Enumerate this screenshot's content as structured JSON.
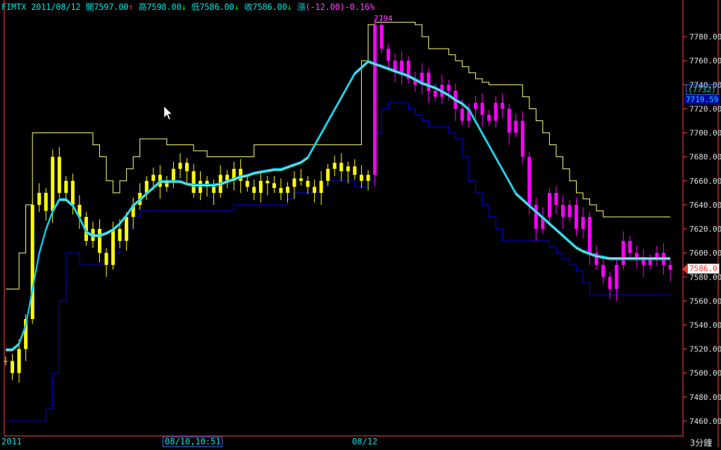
{
  "header": {
    "symbol": "FIMTX",
    "date": "2011/08/12",
    "open_label": "開",
    "open": "7597.00",
    "open_arrow": "↑",
    "high_label": "高",
    "high": "7598.00",
    "high_arrow": "↓",
    "low_label": "低",
    "low": "7586.00",
    "low_arrow": "↓",
    "close_label": "收",
    "close": "7586.00",
    "close_arrow": "↓",
    "change_label": "漲",
    "change": "(-12.00)-0.16%"
  },
  "bottom": {
    "year_label": "2011",
    "cursor_time": "08/10,10:51",
    "date_mark": "08/12",
    "period": "3分鐘"
  },
  "tags": {
    "peak_label": "7794",
    "marker_box": "(7732)",
    "indicator_value": "7719.59",
    "last_price": "7586.0"
  },
  "colors": {
    "background": "#000000",
    "up_candle": "#ffff00",
    "down_candle": "#ff00ff",
    "upper_band": "#ffff80",
    "lower_band": "#0000cc",
    "ma_cyan": "#00ccff",
    "ma_white": "#ffffff",
    "ma_green": "#00aa88",
    "axis_border": "#ff4040"
  },
  "chart_data": {
    "type": "line",
    "ylim": [
      7450,
      7800
    ],
    "y_ticks": [
      7460,
      7480,
      7500,
      7520,
      7540,
      7560,
      7580,
      7600,
      7620,
      7640,
      7660,
      7680,
      7700,
      7720,
      7740,
      7760,
      7780
    ],
    "close": [
      7510,
      7500,
      7520,
      7545,
      7640,
      7650,
      7635,
      7680,
      7650,
      7660,
      7640,
      7630,
      7610,
      7620,
      7600,
      7590,
      7620,
      7610,
      7630,
      7640,
      7650,
      7660,
      7665,
      7655,
      7660,
      7670,
      7675,
      7668,
      7650,
      7660,
      7655,
      7650,
      7665,
      7660,
      7670,
      7660,
      7655,
      7650,
      7660,
      7658,
      7654,
      7650,
      7655,
      7662,
      7660,
      7655,
      7650,
      7660,
      7670,
      7675,
      7668,
      7672,
      7665,
      7660,
      7665,
      7790,
      7770,
      7760,
      7750,
      7760,
      7745,
      7740,
      7750,
      7735,
      7730,
      7740,
      7735,
      7720,
      7710,
      7720,
      7725,
      7715,
      7710,
      7725,
      7720,
      7700,
      7710,
      7680,
      7640,
      7620,
      7630,
      7650,
      7640,
      7630,
      7640,
      7620,
      7630,
      7600,
      7590,
      7580,
      7570,
      7590,
      7610,
      7600,
      7595,
      7590,
      7595,
      7600,
      7590,
      7586
    ],
    "upper_band": [
      7570,
      7570,
      7600,
      7640,
      7700,
      7700,
      7700,
      7700,
      7700,
      7700,
      7700,
      7700,
      7700,
      7690,
      7680,
      7660,
      7650,
      7660,
      7670,
      7680,
      7695,
      7695,
      7695,
      7695,
      7690,
      7690,
      7690,
      7690,
      7685,
      7685,
      7680,
      7680,
      7680,
      7680,
      7680,
      7680,
      7680,
      7690,
      7690,
      7690,
      7690,
      7690,
      7690,
      7690,
      7690,
      7690,
      7690,
      7690,
      7690,
      7690,
      7690,
      7690,
      7690,
      7760,
      7790,
      7792,
      7792,
      7792,
      7792,
      7792,
      7792,
      7790,
      7780,
      7770,
      7770,
      7770,
      7765,
      7760,
      7755,
      7750,
      7745,
      7742,
      7740,
      7740,
      7740,
      7740,
      7740,
      7730,
      7720,
      7710,
      7700,
      7690,
      7680,
      7670,
      7660,
      7650,
      7645,
      7640,
      7635,
      7630,
      7630,
      7630,
      7630,
      7630,
      7630,
      7630,
      7630,
      7630,
      7630,
      7630
    ],
    "lower_band": [
      7460,
      7460,
      7460,
      7460,
      7460,
      7460,
      7470,
      7500,
      7560,
      7600,
      7600,
      7590,
      7590,
      7590,
      7590,
      7590,
      7600,
      7610,
      7620,
      7630,
      7635,
      7635,
      7635,
      7635,
      7635,
      7635,
      7635,
      7635,
      7635,
      7635,
      7635,
      7635,
      7635,
      7635,
      7640,
      7640,
      7640,
      7640,
      7640,
      7640,
      7640,
      7640,
      7645,
      7650,
      7650,
      7650,
      7650,
      7655,
      7660,
      7660,
      7660,
      7660,
      7655,
      7655,
      7660,
      7700,
      7720,
      7725,
      7725,
      7725,
      7720,
      7715,
      7710,
      7705,
      7705,
      7705,
      7700,
      7695,
      7680,
      7660,
      7650,
      7640,
      7630,
      7620,
      7610,
      7610,
      7610,
      7610,
      7610,
      7610,
      7610,
      7605,
      7600,
      7595,
      7590,
      7585,
      7575,
      7565,
      7565,
      7565,
      7565,
      7565,
      7565,
      7565,
      7565,
      7565,
      7565,
      7565,
      7565,
      7565
    ],
    "ma_cyan": [
      7520,
      7520,
      7525,
      7540,
      7570,
      7600,
      7620,
      7635,
      7645,
      7645,
      7640,
      7630,
      7618,
      7615,
      7615,
      7617,
      7620,
      7625,
      7632,
      7640,
      7645,
      7650,
      7655,
      7660,
      7660,
      7660,
      7660,
      7658,
      7657,
      7657,
      7657,
      7657,
      7658,
      7660,
      7662,
      7664,
      7665,
      7667,
      7668,
      7669,
      7670,
      7670,
      7672,
      7674,
      7676,
      7680,
      7690,
      7700,
      7710,
      7720,
      7730,
      7740,
      7750,
      7755,
      7760,
      7758,
      7756,
      7754,
      7752,
      7750,
      7748,
      7745,
      7742,
      7740,
      7738,
      7735,
      7732,
      7728,
      7725,
      7720,
      7710,
      7700,
      7690,
      7680,
      7670,
      7660,
      7650,
      7645,
      7640,
      7635,
      7630,
      7625,
      7620,
      7615,
      7610,
      7605,
      7602,
      7600,
      7598,
      7597,
      7596,
      7596,
      7596,
      7596,
      7596,
      7596,
      7596,
      7596,
      7596,
      7596
    ]
  }
}
